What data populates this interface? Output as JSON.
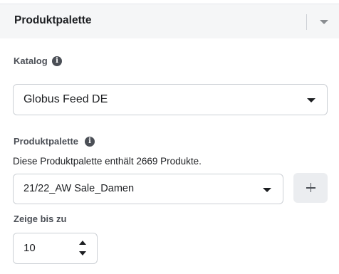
{
  "header": {
    "title": "Produktpalette",
    "collapse_icon": "caret-down-icon"
  },
  "catalog": {
    "label": "Katalog",
    "info_icon": "info-icon",
    "info_symbol": "i",
    "selected": "Globus Feed DE"
  },
  "product_set": {
    "label": "Produktpalette",
    "info_icon": "info-icon",
    "info_symbol": "i",
    "description": "Diese Produktpalette enthält 2669 Produkte.",
    "selected": "21/22_AW Sale_Damen",
    "add_icon": "plus-icon"
  },
  "show_up_to": {
    "label": "Zeige bis zu",
    "value": "10"
  },
  "colors": {
    "header_bg": "#f5f6f7",
    "label": "#4b4f56",
    "text": "#1c1e21",
    "border": "#ccd0d5",
    "button_bg": "#ebedf0"
  }
}
